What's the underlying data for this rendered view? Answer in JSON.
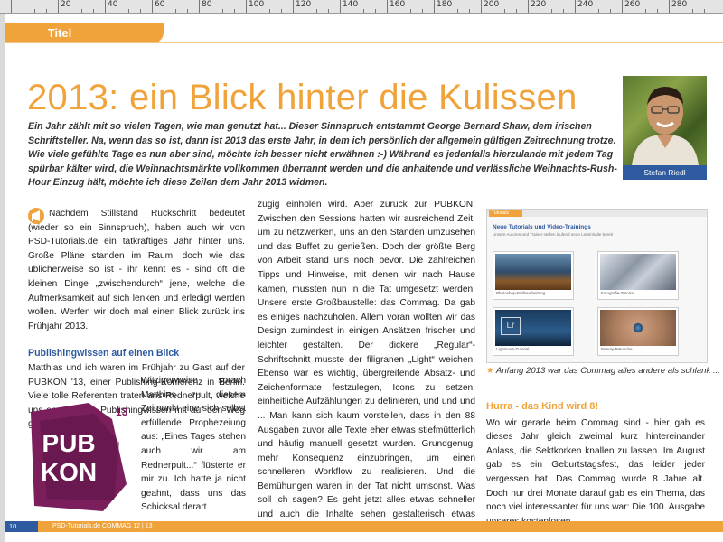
{
  "ruler": {
    "labels": [
      "20",
      "40",
      "60",
      "80",
      "100",
      "120",
      "140",
      "160",
      "180",
      "200",
      "220",
      "240",
      "260",
      "280"
    ]
  },
  "tab": {
    "label": "Titel"
  },
  "headline": "2013: ein Blick hinter die Kulissen",
  "intro": "Ein Jahr zählt mit so vielen Tagen, wie man genutzt hat... Dieser Sinnspruch entstammt George Bernard Shaw, dem irischen Schriftsteller. Na, wenn das so ist, dann ist 2013 das erste Jahr, in dem ich persönlich der allgemein gültigen Zeitrechnung trotze. Wie viele gefühlte Tage es nun aber sind, möchte ich besser nicht erwähnen :-) Während es jedenfalls hierzulande mit jedem Tag spürbar kälter wird, die Weihnachtsmärkte vollkommen überrannt werden und die anhaltende und verlässliche Weihnachts-Rush-Hour Einzug hält, möchte ich diese Zeilen dem Jahr 2013 widmen.",
  "author": {
    "name": "Stefan Riedl"
  },
  "col1": {
    "p1": "Nachdem Stillstand Rückschritt bedeutet (wieder so ein Sinnspruch), haben auch wir von PSD-Tutorials.de ein tatkräftiges Jahr hinter uns. Große Pläne standen im Raum, doch wie das üblicherweise so ist - ihr kennt es - sind oft die kleinen Dinge „zwischendurch“ jene, welche die Aufmerksamkeit auf sich lenken und erledigt werden wollen. Werfen wir doch mal einen Blick zurück ins Frühjahr 2013.",
    "subhead": "Publishingwissen auf einen Blick",
    "p2": "Matthias und ich waren im Frühjahr zu Gast auf der PUBKON '13, einer Publishing-Konferenz in Berlin. Viele tolle Referenten traten ans Rednerpult, welche uns spannendes Publishingwissen mit auf den Weg gaben.",
    "p3": "Witzigerweise sprach Matthias zu diesem Zeitpunkt eine sich selbst erfüllende Prophezeiung aus: „Eines Tages stehen auch wir am Rednerpult...“ flüsterte er mir zu. Ich hatte ja nicht geahnt, dass uns das Schicksal derart"
  },
  "col2": {
    "text": "zügig einholen wird. Aber zurück zur PUBKON: Zwischen den Sessions hatten wir ausreichend Zeit, um zu netzwerken, uns an den Ständen umzusehen und das Buffet zu genießen. Doch der größte Berg von Arbeit stand uns noch bevor. Die zahlreichen Tipps und Hinweise, mit denen wir nach Hause kamen, mussten nun in die Tat umgesetzt werden. Unsere erste Großbaustelle: das Commag. Da gab es einiges nachzuholen. Allem voran wollten wir das Design zumindest in einigen Ansätzen frischer und leichter gestalten. Der dickere „Regular“-Schriftschnitt musste der filigranen „Light“ weichen. Ebenso war es wichtig, übergreifende Absatz- und Zeichenformate festzulegen, Icons zu setzen, einheitliche Aufzählungen zu definieren, und und und ... Man kann sich kaum vorstellen, dass in den 88 Ausgaben zuvor alle Texte eher etwas stiefmütterlich und häufig manuell gesetzt wurden. Grundgenug, mehr Konsequenz einzubringen, um einen schnelleren Workflow zu realisieren. Und die Bemühungen waren in der Tat nicht umsonst. Was soll ich sagen? Es geht jetzt alles etwas schneller und auch die Inhalte sehen gestalterisch etwas hübscher aus."
  },
  "figure": {
    "tab": "Tutorials",
    "title": "Neue Tutorials und Video-Trainings",
    "subtitle": "Unsere Autoren und Trainer stellen laufend neue Lerninhalte bereit",
    "thumbs": [
      {
        "label": "Photoshop-Bildbearbeitung"
      },
      {
        "label": "Fotografie-Tutorial"
      },
      {
        "label": "Lightroom-Tutorial"
      },
      {
        "label": "Beauty-Retusche"
      }
    ],
    "thumb_tag": "Lr",
    "caption": "Anfang 2013 war das Commag alles andere als schlank ..."
  },
  "col3": {
    "subhead": "Hurra - das Kind wird 8!",
    "text": "Wo wir gerade beim Commag sind - hier gab es dieses Jahr gleich zweimal kurz hintereinander Anlass, die Sektkorken knallen zu lassen. Im August gab es ein Geburtstagsfest, das leider jeder vergessen hat. Das Commag wurde 8 Jahre alt. Doch nur drei Monate darauf gab es ein Thema, das noch viel interessanter für uns war: Die 100. Ausgabe unseres kostenlosen"
  },
  "logo": {
    "line1": "PUB",
    "line2": "KON",
    "sup": "13"
  },
  "footer": {
    "page": "10",
    "text": "PSD-Tutorials.de   COMMAG 12 | 13"
  },
  "colors": {
    "accent": "#f0a33a",
    "blue": "#2e5aa0",
    "logo": "#7a1f5c"
  }
}
